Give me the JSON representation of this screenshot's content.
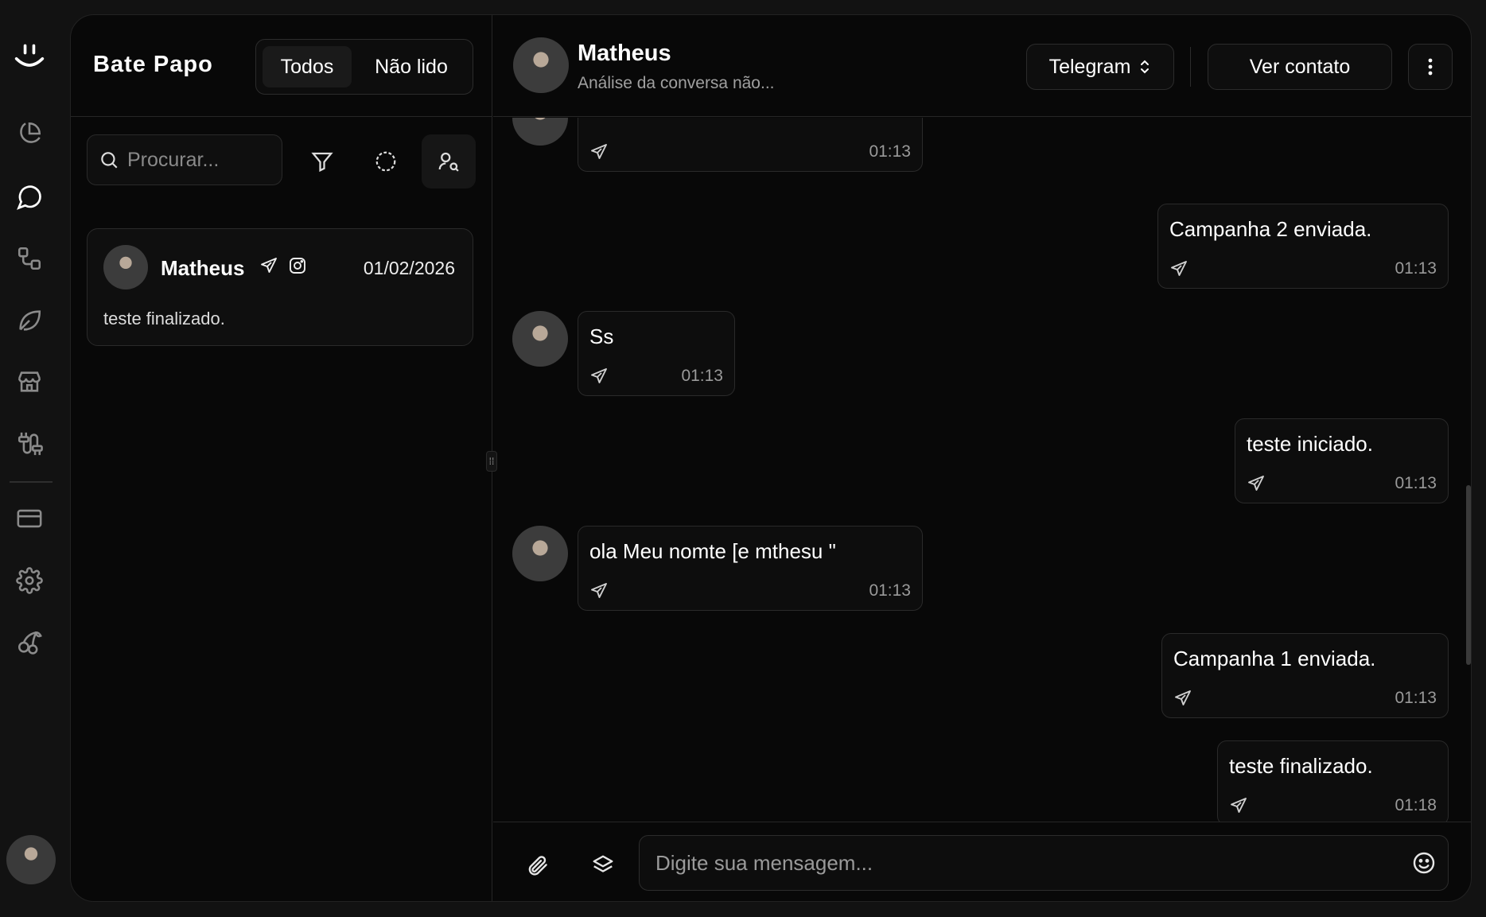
{
  "sidebar": {
    "logo_icon": "smile-logo-icon",
    "items": [
      {
        "name": "dashboard",
        "icon": "pie-chart-icon",
        "active": false
      },
      {
        "name": "chat",
        "icon": "message-circle-icon",
        "active": true
      },
      {
        "name": "workflows",
        "icon": "flow-icon",
        "active": false
      },
      {
        "name": "leaf",
        "icon": "leaf-icon",
        "active": false
      },
      {
        "name": "store",
        "icon": "store-icon",
        "active": false
      },
      {
        "name": "integrations",
        "icon": "cable-icon",
        "active": false
      },
      {
        "name": "billing",
        "icon": "credit-card-icon",
        "active": false
      },
      {
        "name": "settings",
        "icon": "gear-icon",
        "active": false
      },
      {
        "name": "extras",
        "icon": "cherries-icon",
        "active": false
      }
    ]
  },
  "list_panel": {
    "title": "Bate Papo",
    "filters": {
      "all": "Todos",
      "unread": "Não lido",
      "selected": "Todos"
    },
    "search": {
      "placeholder": "Procurar...",
      "value": ""
    },
    "conversations": [
      {
        "name": "Matheus",
        "channels": [
          "telegram",
          "instagram"
        ],
        "date": "01/02/2026",
        "preview": "teste finalizado."
      }
    ]
  },
  "chat": {
    "contact_name": "Matheus",
    "subtitle": "Análise da conversa não...",
    "channel": "Telegram",
    "view_contact_label": "Ver contato",
    "messages": [
      {
        "side": "left",
        "text": "",
        "time": "01:13"
      },
      {
        "side": "right",
        "text": "Campanha 2 enviada.",
        "time": "01:13"
      },
      {
        "side": "left",
        "text": "Ss",
        "time": "01:13"
      },
      {
        "side": "right",
        "text": "teste iniciado.",
        "time": "01:13"
      },
      {
        "side": "left",
        "text": "ola Meu nomte [e mthesu \"",
        "time": "01:13"
      },
      {
        "side": "right",
        "text": "Campanha 1 enviada.",
        "time": "01:13"
      },
      {
        "side": "right",
        "text": "teste finalizado.",
        "time": "01:18"
      }
    ],
    "composer": {
      "placeholder": "Digite sua mensagem...",
      "value": ""
    }
  },
  "colors": {
    "background": "#121212",
    "panel": "#080808",
    "border": "#2a2a2a",
    "text": "#ffffff",
    "muted": "#9a9a9a"
  }
}
